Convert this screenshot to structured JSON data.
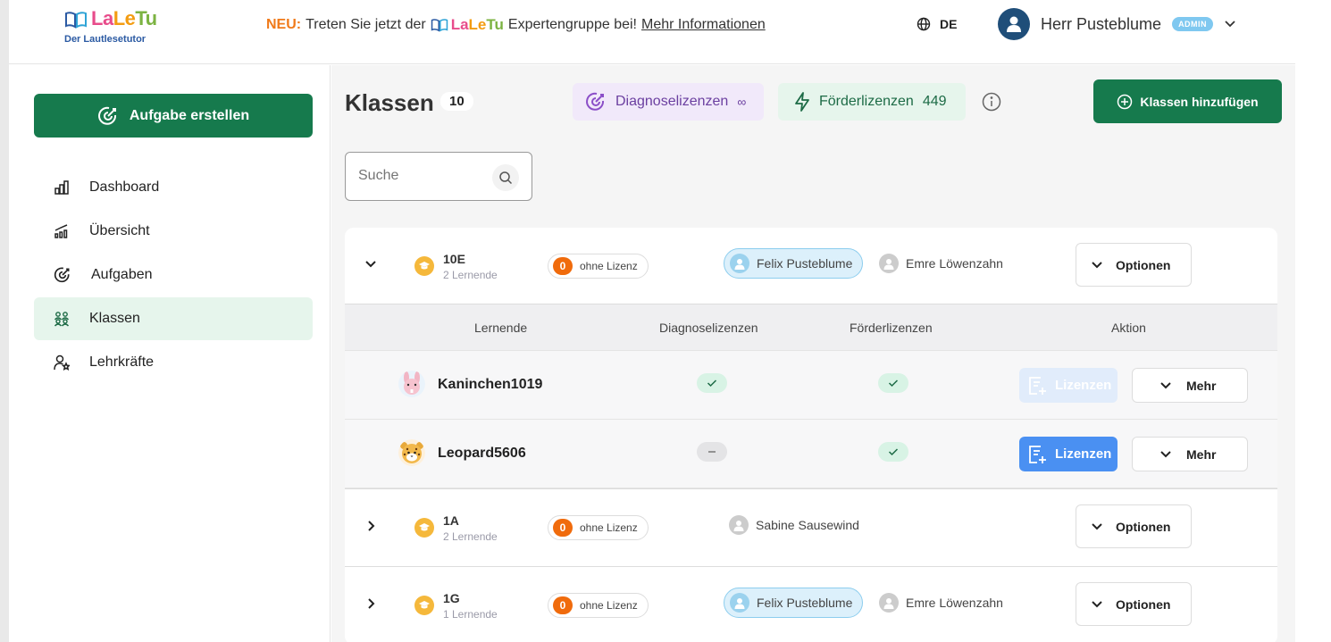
{
  "header": {
    "logo_parts": [
      "La",
      "Le",
      "Tu"
    ],
    "logo_subtitle": "Der Lautlesetutor",
    "announce_prefix": "NEU:",
    "announce_text_1": "Treten Sie jetzt der",
    "announce_logo_parts": [
      "La",
      "Le",
      "Tu"
    ],
    "announce_text_2": "Expertengruppe bei!",
    "announce_link": "Mehr Informationen",
    "language": "DE",
    "user_name": "Herr Pusteblume",
    "user_role": "ADMIN"
  },
  "sidebar": {
    "create_label": "Aufgabe erstellen",
    "items": [
      {
        "label": "Dashboard",
        "icon": "bar-chart-icon"
      },
      {
        "label": "Übersicht",
        "icon": "trend-chart-icon"
      },
      {
        "label": "Aufgaben",
        "icon": "target-icon"
      },
      {
        "label": "Klassen",
        "icon": "group-icon",
        "active": true
      },
      {
        "label": "Lehrkräfte",
        "icon": "teacher-icon"
      }
    ]
  },
  "main": {
    "title": "Klassen",
    "count": "10",
    "diag_label": "Diagnoselizenzen",
    "diag_value": "∞",
    "foerd_label": "Förderlizenzen",
    "foerd_value": "449",
    "add_label": "Klassen hinzufügen",
    "search_placeholder": "Suche"
  },
  "classes": [
    {
      "name": "10E",
      "students": "2 Lernende",
      "no_license": "0",
      "no_license_label": "ohne Lizenz",
      "teachers": [
        "Felix Pusteblume",
        "Emre Löwenzahn"
      ],
      "options_label": "Optionen",
      "expanded": true
    },
    {
      "name": "1A",
      "students": "2 Lernende",
      "no_license": "0",
      "no_license_label": "ohne Lizenz",
      "teachers": [
        "Sabine Sausewind"
      ],
      "options_label": "Optionen",
      "expanded": false
    },
    {
      "name": "1G",
      "students": "1 Lernende",
      "no_license": "0",
      "no_license_label": "ohne Lizenz",
      "teachers": [
        "Felix Pusteblume",
        "Emre Löwenzahn"
      ],
      "options_label": "Optionen",
      "expanded": false
    }
  ],
  "student_table": {
    "headers": [
      "Lernende",
      "Diagnoselizenzen",
      "Förderlizenzen",
      "Aktion"
    ],
    "rows": [
      {
        "name": "Kaninchen1019",
        "avatar": "bunny-avatar",
        "diag": true,
        "foerd": true,
        "license_label": "Lizenzen",
        "license_enabled": false,
        "more_label": "Mehr"
      },
      {
        "name": "Leopard5606",
        "avatar": "leopard-avatar",
        "diag": false,
        "foerd": true,
        "license_label": "Lizenzen",
        "license_enabled": true,
        "more_label": "Mehr"
      }
    ]
  },
  "colors": {
    "primary_green": "#167a4d",
    "accent_orange": "#f06b0c",
    "license_blue": "#4a90f2",
    "admin_badge": "#7fc8f0"
  }
}
